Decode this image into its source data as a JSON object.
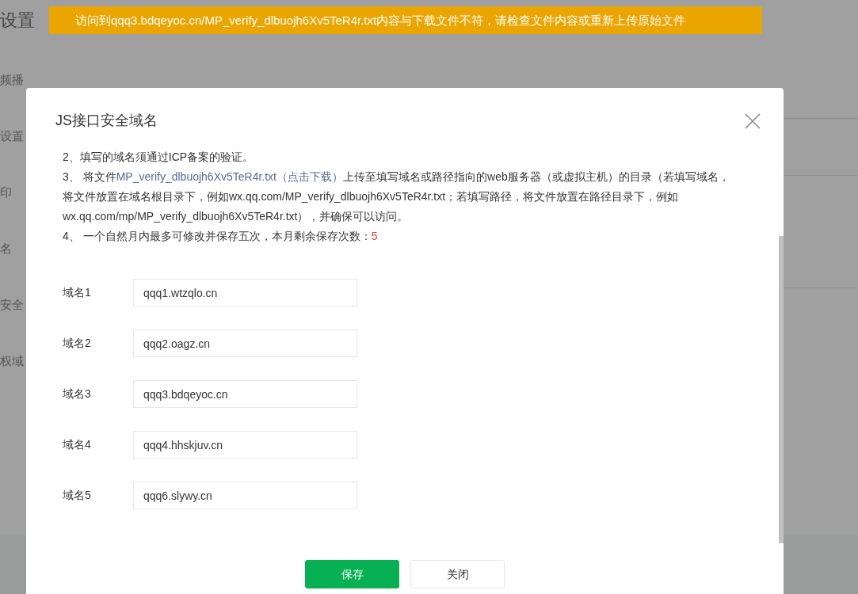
{
  "page": {
    "title": "设置",
    "side_labels": [
      "频播",
      "设置",
      "印",
      "名",
      "安全",
      "权域"
    ]
  },
  "toast": {
    "text": "访问到qqq3.bdqeyoc.cn/MP_verify_dlbuojh6Xv5TeR4r.txt内容与下载文件不符，请检查文件内容或重新上传原始文件"
  },
  "dialog": {
    "title": "JS接口安全域名",
    "notes": [
      {
        "kind": "text",
        "text": "2、填写的域名须通过ICP备案的验证。"
      },
      {
        "kind": "download",
        "before": "3、 将文件",
        "link": "MP_verify_dlbuojh6Xv5TeR4r.txt（点击下载）",
        "after": "上传至填写域名或路径指向的web服务器（或虚拟主机）的目录（若填写域名，将文件放置在域名根目录下，例如wx.qq.com/MP_verify_dlbuojh6Xv5TeR4r.txt；若填写路径，将文件放置在路径目录下，例如wx.qq.com/mp/MP_verify_dlbuojh6Xv5TeR4r.txt），并确保可以访问。"
      },
      {
        "kind": "count",
        "text": "4、 一个自然月内最多可修改并保存五次，本月剩余保存次数：",
        "count": "5"
      }
    ],
    "fields": [
      {
        "label": "域名1",
        "value": "qqq1.wtzqlo.cn"
      },
      {
        "label": "域名2",
        "value": "qqq2.oagz.cn"
      },
      {
        "label": "域名3",
        "value": "qqq3.bdqeyoc.cn"
      },
      {
        "label": "域名4",
        "value": "qqq4.hhskjuv.cn"
      },
      {
        "label": "域名5",
        "value": "qqq6.slywy.cn"
      }
    ],
    "buttons": [
      {
        "kind": "primary",
        "label": "保存"
      },
      {
        "kind": "default",
        "label": "关闭"
      }
    ]
  }
}
